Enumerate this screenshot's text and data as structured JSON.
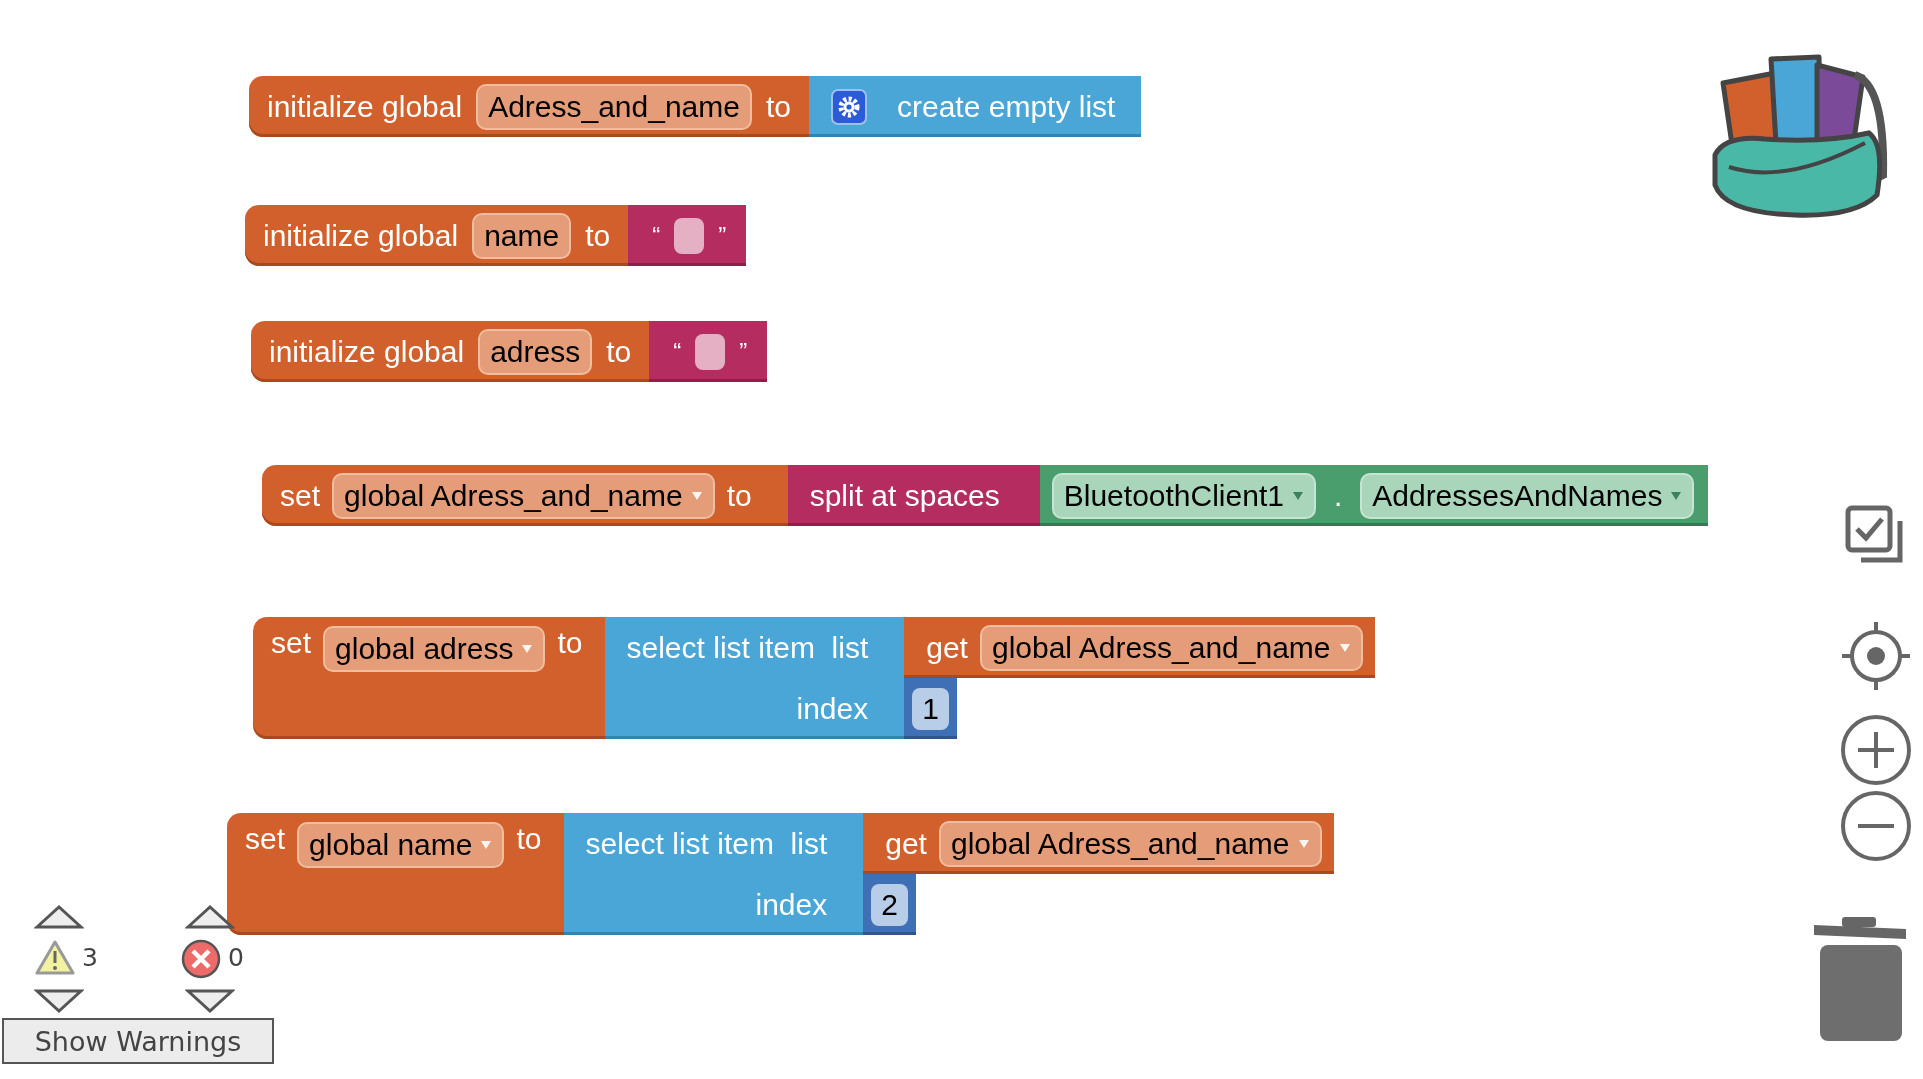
{
  "blocks": [
    {
      "kind": "init",
      "label": "initialize global",
      "variable": "Adress_and_name",
      "connector": "to",
      "value": {
        "kind": "create_list",
        "label": "create empty list"
      }
    },
    {
      "kind": "init",
      "label": "initialize global",
      "variable": "name",
      "connector": "to",
      "value": {
        "kind": "text",
        "open_quote": "“",
        "close_quote": "”"
      }
    },
    {
      "kind": "init",
      "label": "initialize global",
      "variable": "adress",
      "connector": "to",
      "value": {
        "kind": "text",
        "open_quote": "“",
        "close_quote": "”"
      }
    },
    {
      "kind": "set",
      "label": "set",
      "variable": "global Adress_and_name",
      "connector": "to",
      "value": {
        "kind": "split",
        "label": "split at spaces",
        "arg": {
          "kind": "component_property",
          "component": "BluetoothClient1",
          "dot": ".",
          "property": "AddressesAndNames"
        }
      }
    },
    {
      "kind": "set",
      "label": "set",
      "variable": "global adress",
      "connector": "to",
      "value": {
        "kind": "select",
        "label": "select list item  list",
        "index_label": "index",
        "list": {
          "kind": "get",
          "label": "get",
          "variable": "global Adress_and_name"
        },
        "index": "1"
      }
    },
    {
      "kind": "set",
      "label": "set",
      "variable": "global name",
      "connector": "to",
      "value": {
        "kind": "select",
        "label": "select list item  list",
        "index_label": "index",
        "list": {
          "kind": "get",
          "label": "get",
          "variable": "global Adress_and_name"
        },
        "index": "2"
      }
    }
  ],
  "warnings": {
    "count": "3"
  },
  "errors": {
    "count": "0"
  },
  "show_warnings_button": "Show Warnings"
}
